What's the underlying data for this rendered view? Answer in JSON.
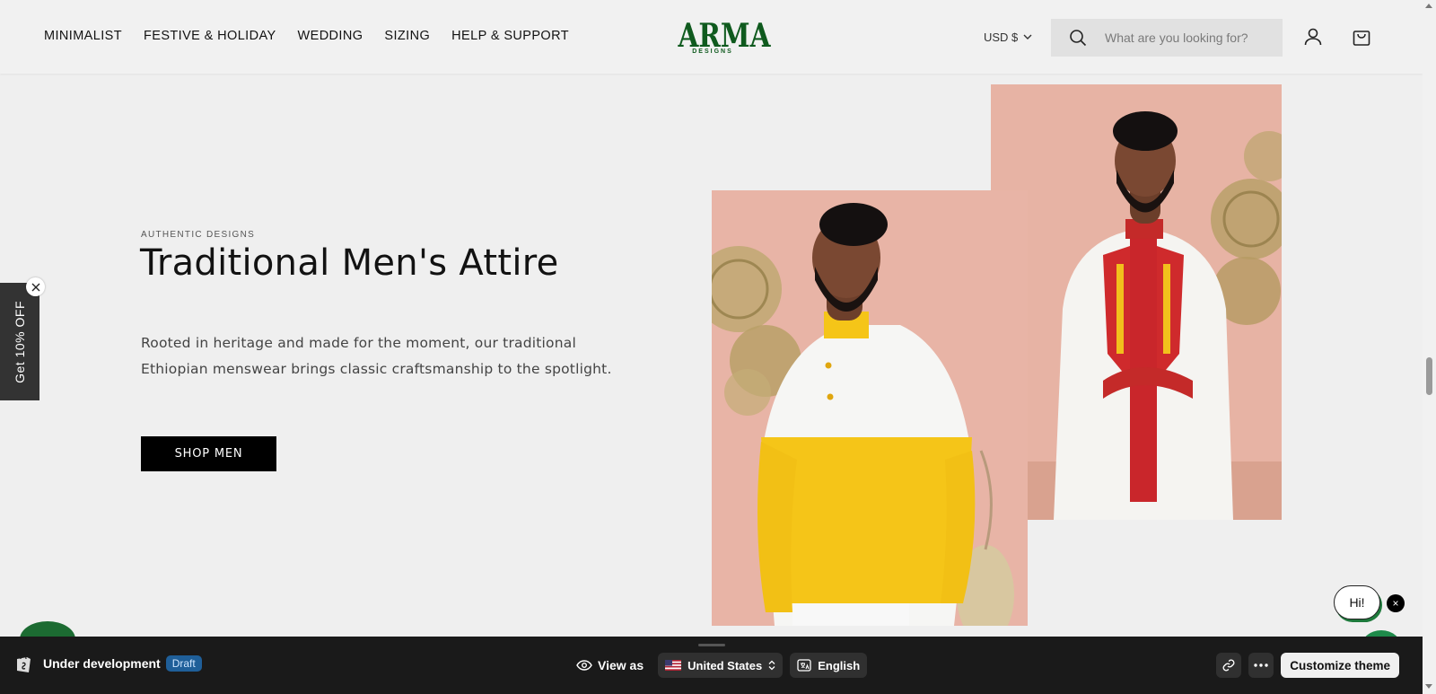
{
  "header": {
    "nav": [
      "MINIMALIST",
      "FESTIVE & HOLIDAY",
      "WEDDING",
      "SIZING",
      "HELP & SUPPORT"
    ],
    "logo": {
      "main": "ARMA",
      "sub": "DESIGNS"
    },
    "currency": "USD $",
    "search_placeholder": "What are you looking for?",
    "icons": [
      "search-icon",
      "account-icon",
      "cart-icon",
      "chevron-down-icon"
    ]
  },
  "hero": {
    "eyebrow": "AUTHENTIC DESIGNS",
    "title": "Traditional Men's Attire",
    "description": "Rooted in heritage and made for the moment, our traditional Ethiopian menswear brings classic craftsmanship to the spotlight.",
    "button": "SHOP MEN"
  },
  "discount_tab": {
    "label": "Get 10% OFF"
  },
  "chat": {
    "greeting": "Hi!",
    "close": "×"
  },
  "preview_bar": {
    "status": "Under development",
    "badge": "Draft",
    "view_as": "View as",
    "country": "United States",
    "language": "English",
    "customize": "Customize theme"
  },
  "colors": {
    "logo_green": "#0f5a1e",
    "background": "#efefef",
    "button_black": "#000000",
    "bar_dark": "#1a1a1a",
    "draft_blue": "#1f5f99"
  }
}
